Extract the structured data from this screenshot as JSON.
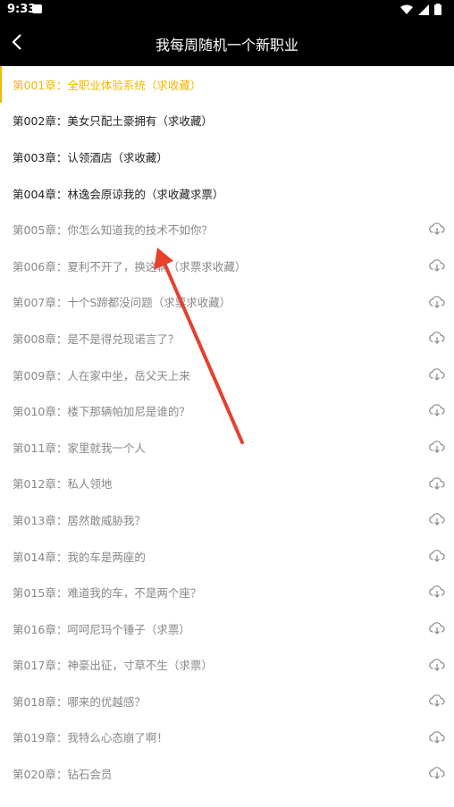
{
  "status": {
    "time": "9:33"
  },
  "header": {
    "title": "我每周随机一个新职业"
  },
  "chapters": [
    {
      "label": "第001章：全职业体验系统（求收藏）",
      "state": "current"
    },
    {
      "label": "第002章：美女只配土豪拥有（求收藏）",
      "state": "downloaded"
    },
    {
      "label": "第003章：认领酒店（求收藏）",
      "state": "downloaded"
    },
    {
      "label": "第004章：林逸会原谅我的（求收藏求票）",
      "state": "downloaded"
    },
    {
      "label": "第005章：你怎么知道我的技术不如你？",
      "state": "cloud"
    },
    {
      "label": "第006章：夏利不开了，换这辆（求票求收藏）",
      "state": "cloud"
    },
    {
      "label": "第007章：十个S蹄都没问题（求票求收藏）",
      "state": "cloud"
    },
    {
      "label": "第008章：是不是得兑现诺言了？",
      "state": "cloud"
    },
    {
      "label": "第009章：人在家中坐，岳父天上来",
      "state": "cloud"
    },
    {
      "label": "第010章：楼下那辆帕加尼是谁的？",
      "state": "cloud"
    },
    {
      "label": "第011章：家里就我一个人",
      "state": "cloud"
    },
    {
      "label": "第012章：私人领地",
      "state": "cloud"
    },
    {
      "label": "第013章：居然敢威胁我？",
      "state": "cloud"
    },
    {
      "label": "第014章：我的车是两座的",
      "state": "cloud"
    },
    {
      "label": "第015章：难道我的车，不是两个座？",
      "state": "cloud"
    },
    {
      "label": "第016章：呵呵尼玛个锤子（求票）",
      "state": "cloud"
    },
    {
      "label": "第017章：神豪出征，寸草不生（求票）",
      "state": "cloud"
    },
    {
      "label": "第018章：哪来的优越感？",
      "state": "cloud"
    },
    {
      "label": "第019章：我特么心态崩了啊！",
      "state": "cloud"
    },
    {
      "label": "第020章：钻石会员",
      "state": "cloud"
    }
  ],
  "colors": {
    "accent": "#f2b800",
    "annotation_arrow": "#e5412f"
  }
}
